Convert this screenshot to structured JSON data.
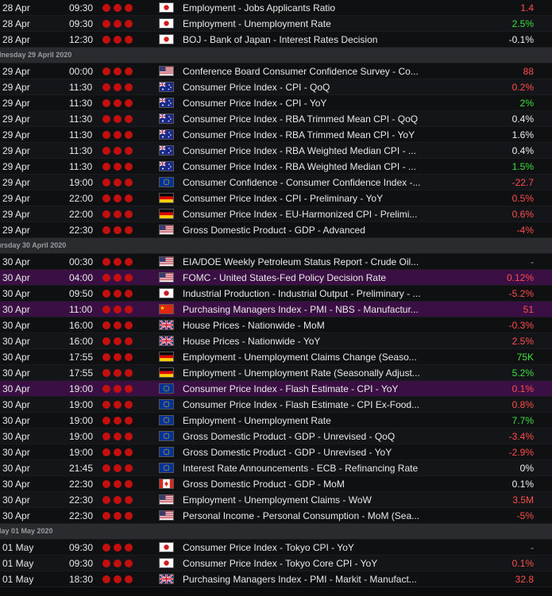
{
  "colors": {
    "negative": "#ff4d4d",
    "positive": "#3ee03e",
    "neutral": "#f0f0f0",
    "highlight_row": "#3a0f44",
    "importance_dot": "#c40f0f"
  },
  "rows": [
    {
      "kind": "event",
      "date": "28 Apr",
      "time": "09:30",
      "flag": "JP",
      "event": "Employment - Jobs Applicants Ratio",
      "actual": "1.4",
      "tone": "neg"
    },
    {
      "kind": "event",
      "date": "28 Apr",
      "time": "09:30",
      "flag": "JP",
      "event": "Employment - Unemployment Rate",
      "actual": "2.5%",
      "tone": "pos"
    },
    {
      "kind": "event",
      "date": "28 Apr",
      "time": "12:30",
      "flag": "JP",
      "event": "BOJ - Bank of Japan - Interest Rates Decision",
      "actual": "-0.1%",
      "tone": "neu"
    },
    {
      "kind": "section",
      "label": "dnesday 29 April 2020"
    },
    {
      "kind": "event",
      "date": "29 Apr",
      "time": "00:00",
      "flag": "US",
      "event": "Conference Board Consumer Confidence Survey - Co...",
      "actual": "88",
      "tone": "neg"
    },
    {
      "kind": "event",
      "date": "29 Apr",
      "time": "11:30",
      "flag": "AU",
      "event": "Consumer Price Index - CPI - QoQ",
      "actual": "0.2%",
      "tone": "neg"
    },
    {
      "kind": "event",
      "date": "29 Apr",
      "time": "11:30",
      "flag": "AU",
      "event": "Consumer Price Index - CPI - YoY",
      "actual": "2%",
      "tone": "pos"
    },
    {
      "kind": "event",
      "date": "29 Apr",
      "time": "11:30",
      "flag": "AU",
      "event": "Consumer Price Index - RBA Trimmed Mean CPI - QoQ",
      "actual": "0.4%",
      "tone": "neu"
    },
    {
      "kind": "event",
      "date": "29 Apr",
      "time": "11:30",
      "flag": "AU",
      "event": "Consumer Price Index - RBA Trimmed Mean CPI - YoY",
      "actual": "1.6%",
      "tone": "neu"
    },
    {
      "kind": "event",
      "date": "29 Apr",
      "time": "11:30",
      "flag": "AU",
      "event": "Consumer Price Index - RBA Weighted Median CPI - ...",
      "actual": "0.4%",
      "tone": "neu"
    },
    {
      "kind": "event",
      "date": "29 Apr",
      "time": "11:30",
      "flag": "AU",
      "event": "Consumer Price Index - RBA Weighted Median CPI - ...",
      "actual": "1.5%",
      "tone": "pos"
    },
    {
      "kind": "event",
      "date": "29 Apr",
      "time": "19:00",
      "flag": "EU",
      "event": "Consumer Confidence - Consumer Confidence Index -...",
      "actual": "-22.7",
      "tone": "neg"
    },
    {
      "kind": "event",
      "date": "29 Apr",
      "time": "22:00",
      "flag": "DE",
      "event": "Consumer Price Index - CPI - Preliminary - YoY",
      "actual": "0.5%",
      "tone": "neg"
    },
    {
      "kind": "event",
      "date": "29 Apr",
      "time": "22:00",
      "flag": "DE",
      "event": "Consumer Price Index - EU-Harmonized CPI - Prelimi...",
      "actual": "0.6%",
      "tone": "neg"
    },
    {
      "kind": "event",
      "date": "29 Apr",
      "time": "22:30",
      "flag": "US",
      "event": "Gross Domestic Product - GDP - Advanced",
      "actual": "-4%",
      "tone": "neg"
    },
    {
      "kind": "section",
      "label": "ursday 30 April 2020"
    },
    {
      "kind": "event",
      "date": "30 Apr",
      "time": "00:30",
      "flag": "US",
      "event": "EIA/DOE Weekly Petroleum Status Report - Crude Oil...",
      "actual": "-",
      "tone": "dash"
    },
    {
      "kind": "event",
      "date": "30 Apr",
      "time": "04:00",
      "flag": "US",
      "event": "FOMC - United States-Fed Policy Decision Rate",
      "actual": "0.12%",
      "tone": "neg",
      "highlight": true
    },
    {
      "kind": "event",
      "date": "30 Apr",
      "time": "09:50",
      "flag": "JP",
      "event": "Industrial Production - Industrial Output - Preliminary - ...",
      "actual": "-5.2%",
      "tone": "neg"
    },
    {
      "kind": "event",
      "date": "30 Apr",
      "time": "11:00",
      "flag": "CN",
      "event": "Purchasing Managers Index - PMI - NBS - Manufactur...",
      "actual": "51",
      "tone": "neg",
      "highlight": true
    },
    {
      "kind": "event",
      "date": "30 Apr",
      "time": "16:00",
      "flag": "GB",
      "event": "House Prices - Nationwide - MoM",
      "actual": "-0.3%",
      "tone": "neg"
    },
    {
      "kind": "event",
      "date": "30 Apr",
      "time": "16:00",
      "flag": "GB",
      "event": "House Prices - Nationwide - YoY",
      "actual": "2.5%",
      "tone": "neg"
    },
    {
      "kind": "event",
      "date": "30 Apr",
      "time": "17:55",
      "flag": "DE",
      "event": "Employment - Unemployment Claims Change (Seaso...",
      "actual": "75K",
      "tone": "pos"
    },
    {
      "kind": "event",
      "date": "30 Apr",
      "time": "17:55",
      "flag": "DE",
      "event": "Employment - Unemployment Rate (Seasonally Adjust...",
      "actual": "5.2%",
      "tone": "pos"
    },
    {
      "kind": "event",
      "date": "30 Apr",
      "time": "19:00",
      "flag": "EU",
      "event": "Consumer Price Index - Flash Estimate - CPI - YoY",
      "actual": "0.1%",
      "tone": "neg",
      "highlight": true
    },
    {
      "kind": "event",
      "date": "30 Apr",
      "time": "19:00",
      "flag": "EU",
      "event": "Consumer Price Index - Flash Estimate - CPI Ex-Food...",
      "actual": "0.8%",
      "tone": "neg"
    },
    {
      "kind": "event",
      "date": "30 Apr",
      "time": "19:00",
      "flag": "EU",
      "event": "Employment - Unemployment Rate",
      "actual": "7.7%",
      "tone": "pos"
    },
    {
      "kind": "event",
      "date": "30 Apr",
      "time": "19:00",
      "flag": "EU",
      "event": "Gross Domestic Product - GDP - Unrevised - QoQ",
      "actual": "-3.4%",
      "tone": "neg"
    },
    {
      "kind": "event",
      "date": "30 Apr",
      "time": "19:00",
      "flag": "EU",
      "event": "Gross Domestic Product - GDP - Unrevised - YoY",
      "actual": "-2.9%",
      "tone": "neg"
    },
    {
      "kind": "event",
      "date": "30 Apr",
      "time": "21:45",
      "flag": "EU",
      "event": "Interest Rate Announcements - ECB - Refinancing Rate",
      "actual": "0%",
      "tone": "neu"
    },
    {
      "kind": "event",
      "date": "30 Apr",
      "time": "22:30",
      "flag": "CA",
      "event": "Gross Domestic Product - GDP - MoM",
      "actual": "0.1%",
      "tone": "neu"
    },
    {
      "kind": "event",
      "date": "30 Apr",
      "time": "22:30",
      "flag": "US",
      "event": "Employment - Unemployment Claims - WoW",
      "actual": "3.5M",
      "tone": "neg"
    },
    {
      "kind": "event",
      "date": "30 Apr",
      "time": "22:30",
      "flag": "US",
      "event": "Personal Income - Personal Consumption - MoM (Sea...",
      "actual": "-5%",
      "tone": "neg"
    },
    {
      "kind": "section",
      "label": "day 01 May 2020"
    },
    {
      "kind": "event",
      "date": "01 May",
      "time": "09:30",
      "flag": "JP",
      "event": "Consumer Price Index - Tokyo CPI - YoY",
      "actual": "-",
      "tone": "dash"
    },
    {
      "kind": "event",
      "date": "01 May",
      "time": "09:30",
      "flag": "JP",
      "event": "Consumer Price Index - Tokyo Core CPI - YoY",
      "actual": "0.1%",
      "tone": "neg"
    },
    {
      "kind": "event",
      "date": "01 May",
      "time": "18:30",
      "flag": "GB",
      "event": "Purchasing Managers Index - PMI - Markit - Manufact...",
      "actual": "32.8",
      "tone": "neg"
    }
  ]
}
